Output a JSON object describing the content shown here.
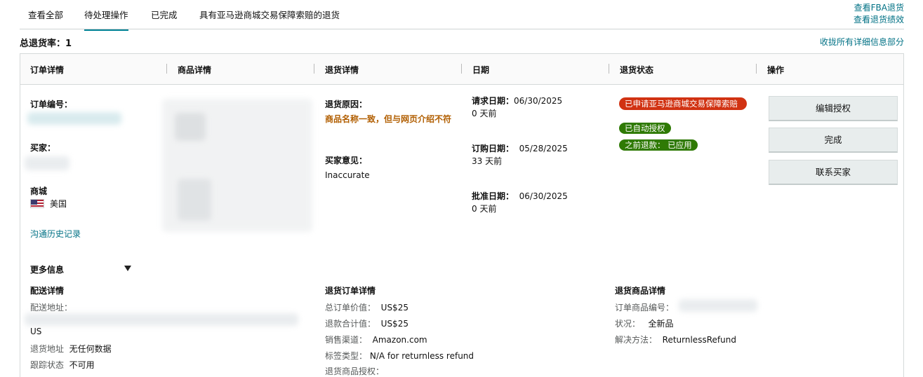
{
  "tabs": [
    {
      "label": "查看全部"
    },
    {
      "label": "待处理操作"
    },
    {
      "label": "已完成"
    },
    {
      "label": "具有亚马逊商城交易保障索赔的退货"
    }
  ],
  "top_links": {
    "fba_returns": "查看FBA退货",
    "return_performance": "查看退货绩效"
  },
  "return_rate": "总退货率：1",
  "collapse_all": "收拢所有详细信息部分",
  "table": {
    "headers": [
      "订单详情",
      "商品详情",
      "退货详情",
      "日期",
      "退货状态",
      "操作"
    ]
  },
  "order": {
    "order_no_label": "订单编号：",
    "buyer_label": "买家：",
    "marketplace_label": "商城",
    "marketplace_value": "美国",
    "comm_history": "沟通历史记录"
  },
  "return_details": {
    "reason_label": "退货原因：",
    "reason_value": "商品名称一致，但与网页介绍不符",
    "buyer_comment_label": "买家意见：",
    "buyer_comment_value": "Inaccurate"
  },
  "dates": {
    "request_label": "请求日期：",
    "request_value": "06/30/2025",
    "request_ago": "0 天前",
    "order_label": "订购日期：",
    "order_value": "05/28/2025",
    "order_ago": "33 天前",
    "approve_label": "批准日期：",
    "approve_value": "06/30/2025",
    "approve_ago": "0 天前"
  },
  "status": {
    "claim": "已申请亚马逊商城交易保障索赔",
    "auto_authorized": "已自动授权",
    "prior_refund": "之前退款：  已应用"
  },
  "actions": {
    "edit_auth": "编辑授权",
    "complete": "完成",
    "contact_buyer": "联系买家"
  },
  "more_info": {
    "title": "更多信息",
    "shipping": {
      "title": "配送详情",
      "address_label": "配送地址：",
      "country": "US",
      "return_addr_label": "退货地址",
      "return_addr_value": "无任何数据",
      "tracking_label": "跟踪状态",
      "tracking_value": "不可用"
    },
    "return_order": {
      "title": "退货订单详情",
      "total_label": "总订单价值：",
      "total_value": "US$25",
      "refund_label": "退款合计值：",
      "refund_value": "US$25",
      "channel_label": "销售渠道：",
      "channel_value": "Amazon.com",
      "label_type_label": "标签类型：",
      "label_type_value": "N/A for returnless refund",
      "auth_label": "退货商品授权："
    },
    "return_item": {
      "title": "退货商品详情",
      "item_no_label": "订单商品编号：",
      "condition_label": "状况：",
      "condition_value": "全新品",
      "resolution_label": "解决方法：",
      "resolution_value": "ReturnlessRefund"
    }
  }
}
